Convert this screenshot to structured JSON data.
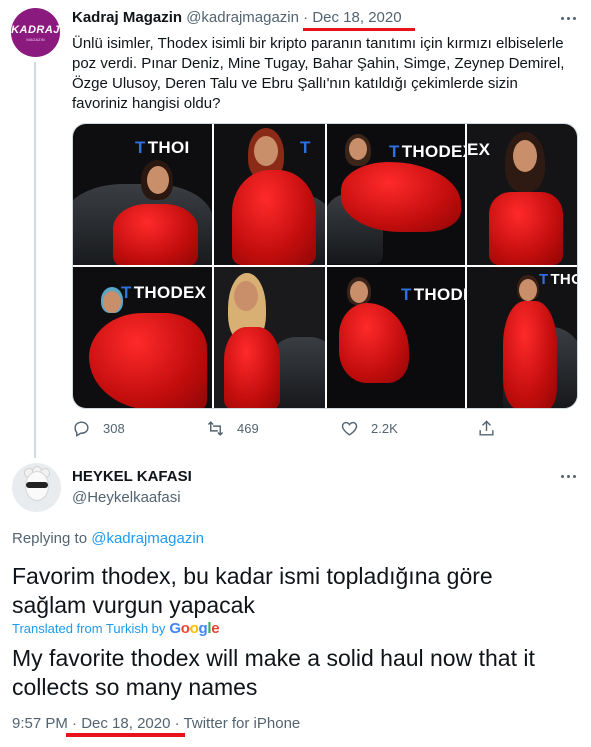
{
  "tweet1": {
    "avatar_text": "KADRAJ",
    "avatar_subtext": "MAGAZIN",
    "name": "Kadraj Magazin",
    "handle": "@kadrajmagazin",
    "separator": "·",
    "date": "Dec 18, 2020",
    "body": "Ünlü isimler, Thodex isimli bir kripto paranın tanıtımı için kırmızı elbiselerle poz verdi. Pınar Deniz, Mine Tugay, Bahar Şahin, Simge, Zeynep Demirel, Özge Ulusoy, Deren Talu ve Ebru Şallı'nın katıldığı çekimlerde sizin favoriniz hangisi oldu?",
    "media_logos": [
      "THOI",
      "T",
      "THODEX",
      "EX",
      "",
      "THODEX",
      "",
      "THODE",
      "THOD"
    ],
    "replies": "308",
    "retweets": "469",
    "likes": "2.2K"
  },
  "tweet2": {
    "name": "HEYKEL KAFASI",
    "handle": "@Heykelkaafasi",
    "replying_prefix": "Replying to",
    "replying_to": "@kadrajmagazin",
    "text": "Favorim thodex, bu kadar ismi topladığına göre sağlam vurgun yapacak",
    "translated_label": "Translated from Turkish by",
    "google": [
      "G",
      "o",
      "o",
      "g",
      "l",
      "e"
    ],
    "translation": "My favorite thodex will make a solid haul now that it collects so many names",
    "time": "9:57 PM",
    "separator": "·",
    "date": "Dec 18, 2020",
    "source": "Twitter for iPhone"
  },
  "colors": {
    "accent": "#1d9bf0",
    "secondary_text": "#536471",
    "annotation_red": "#e8121a",
    "dress_red": "#d41111",
    "thodex_blue": "#2f6fe0"
  },
  "icons": [
    "more-icon",
    "reply-icon",
    "retweet-icon",
    "like-icon",
    "share-icon"
  ]
}
